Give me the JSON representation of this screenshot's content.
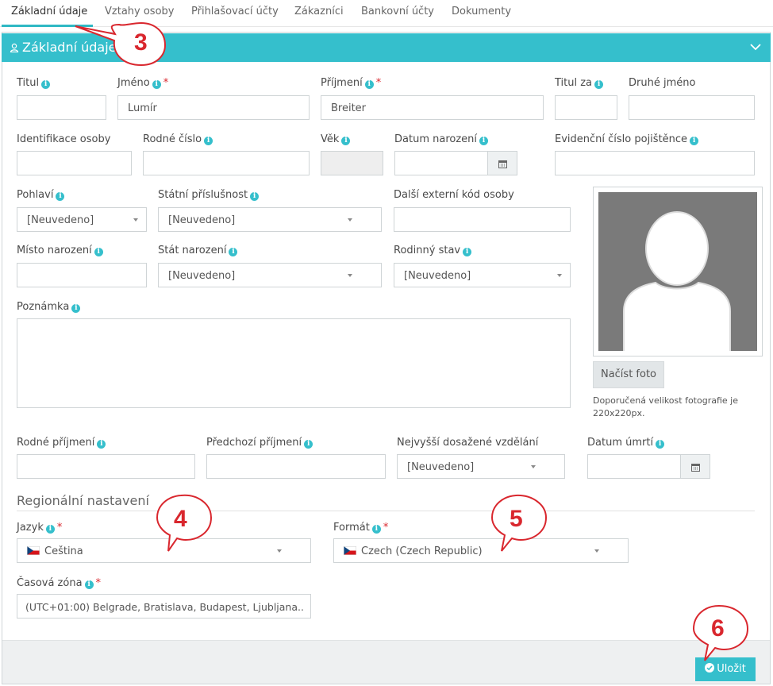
{
  "tabs": [
    "Základní údaje",
    "Vztahy osoby",
    "Přihlašovací účty",
    "Zákazníci",
    "Bankovní účty",
    "Dokumenty"
  ],
  "panel": {
    "title": "Základní údaje"
  },
  "fields": {
    "titul": {
      "label": "Titul",
      "value": ""
    },
    "jmeno": {
      "label": "Jméno",
      "value": "Lumír"
    },
    "prijmeni": {
      "label": "Příjmení",
      "value": "Breiter"
    },
    "titul_za": {
      "label": "Titul za",
      "value": ""
    },
    "druhe_jmeno": {
      "label": "Druhé jméno",
      "value": ""
    },
    "identifikace": {
      "label": "Identifikace osoby",
      "value": ""
    },
    "rodne_cislo": {
      "label": "Rodné číslo",
      "value": ""
    },
    "vek": {
      "label": "Věk",
      "value": ""
    },
    "datum_narozeni": {
      "label": "Datum narození",
      "value": ""
    },
    "evidencni_cislo": {
      "label": "Evidenční číslo pojištěnce",
      "value": ""
    },
    "pohlavi": {
      "label": "Pohlaví",
      "value": "[Neuvedeno]"
    },
    "statni_prislusnost": {
      "label": "Státní příslušnost",
      "value": "[Neuvedeno]"
    },
    "externi_kod": {
      "label": "Další externí kód osoby",
      "value": ""
    },
    "misto_narozeni": {
      "label": "Místo narození",
      "value": ""
    },
    "stat_narozeni": {
      "label": "Stát narození",
      "value": "[Neuvedeno]"
    },
    "rodinny_stav": {
      "label": "Rodinný stav",
      "value": "[Neuvedeno]"
    },
    "poznamka": {
      "label": "Poznámka",
      "value": ""
    },
    "rodne_prijmeni": {
      "label": "Rodné příjmení",
      "value": ""
    },
    "predchozi_prijmeni": {
      "label": "Předchozí příjmení",
      "value": ""
    },
    "vzdelani": {
      "label": "Nejvyšší dosažené vzdělání",
      "value": "[Neuvedeno]"
    },
    "datum_umrti": {
      "label": "Datum úmrtí",
      "value": ""
    }
  },
  "photo": {
    "button": "Načíst foto",
    "hint": "Doporučená velikost fotografie je 220x220px."
  },
  "regional": {
    "title": "Regionální nastavení",
    "jazyk": {
      "label": "Jazyk",
      "value": "Čeština"
    },
    "format": {
      "label": "Formát",
      "value": "Czech (Czech Republic)"
    },
    "timezone": {
      "label": "Časová zóna",
      "value": "(UTC+01:00) Belgrade, Bratislava, Budapest, Ljubljana..."
    }
  },
  "save_button": "Uložit",
  "callouts": [
    "3",
    "4",
    "5",
    "6"
  ],
  "icons": {
    "info": "info-circle-icon",
    "calendar": "calendar-icon",
    "dropdown": "caret-down-icon",
    "flag": "czech-flag-icon",
    "user": "user-icon",
    "chevron": "chevron-down-icon",
    "check": "check-circle-icon"
  },
  "colors": {
    "accent": "#35bfcc",
    "required": "#d9272e",
    "callout": "#d9272e"
  }
}
